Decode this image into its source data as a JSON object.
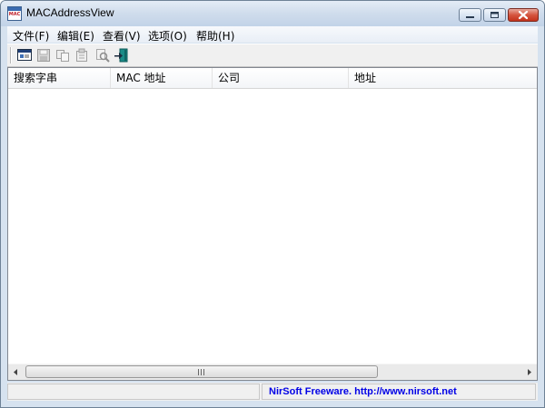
{
  "window": {
    "title": "MACAddressView",
    "icon_text": "MAC"
  },
  "menu": [
    {
      "label": "文件(F)"
    },
    {
      "label": "编辑(E)"
    },
    {
      "label": "查看(V)"
    },
    {
      "label": "选项(O)"
    },
    {
      "label": "帮助(H)"
    }
  ],
  "toolbar": [
    {
      "icon": "html-report-icon",
      "enabled": true
    },
    {
      "icon": "save-icon",
      "enabled": false
    },
    {
      "icon": "copy-icon",
      "enabled": false
    },
    {
      "icon": "properties-icon",
      "enabled": false
    },
    {
      "icon": "find-icon",
      "enabled": false
    },
    {
      "icon": "exit-icon",
      "enabled": true
    }
  ],
  "columns": [
    {
      "label": "搜索字串"
    },
    {
      "label": "MAC 地址"
    },
    {
      "label": "公司"
    },
    {
      "label": "地址"
    }
  ],
  "rows": [],
  "status": {
    "credit": "NirSoft Freeware.  http://www.nirsoft.net"
  },
  "colors": {
    "link": "#0000e6",
    "close_button": "#c4331c",
    "title_bar": "#cfdcec"
  }
}
